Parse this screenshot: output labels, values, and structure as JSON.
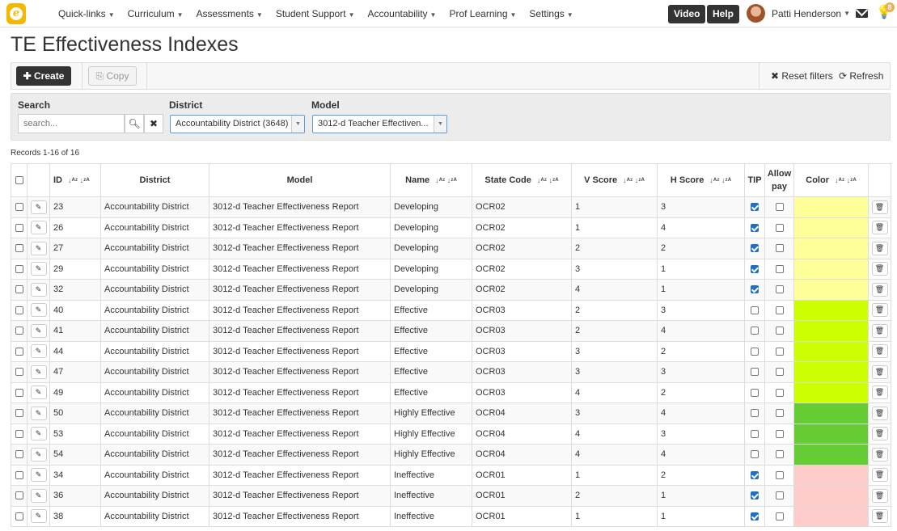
{
  "nav": {
    "logo_letter": "e",
    "menu": [
      "Quick-links",
      "Curriculum",
      "Assessments",
      "Student Support",
      "Accountability",
      "Prof Learning",
      "Settings"
    ],
    "video_label": "Video",
    "help_label": "Help",
    "user_name": "Patti Henderson",
    "notification_count": "8"
  },
  "page": {
    "title": "TE Effectiveness Indexes"
  },
  "toolbar": {
    "create_label": "Create",
    "copy_label": "Copy",
    "reset_label": "Reset filters",
    "refresh_label": "Refresh"
  },
  "filters": {
    "search_label": "Search",
    "search_placeholder": "search...",
    "district_label": "District",
    "district_value": "Accountability District (3648)",
    "model_label": "Model",
    "model_value": "3012-d Teacher Effectiven..."
  },
  "records_text": "Records 1-16 of 16",
  "columns": {
    "id": "ID",
    "district": "District",
    "model": "Model",
    "name": "Name",
    "state_code": "State Code",
    "v_score": "V Score",
    "h_score": "H Score",
    "tip": "TIP",
    "allow_pay": "Allow pay",
    "color": "Color"
  },
  "rows": [
    {
      "id": "23",
      "district": "Accountability District",
      "model": "3012-d Teacher Effectiveness Report",
      "name": "Developing",
      "state_code": "OCR02",
      "v_score": "1",
      "h_score": "3",
      "tip": true,
      "allow_pay": false,
      "color": "#ffff99"
    },
    {
      "id": "26",
      "district": "Accountability District",
      "model": "3012-d Teacher Effectiveness Report",
      "name": "Developing",
      "state_code": "OCR02",
      "v_score": "1",
      "h_score": "4",
      "tip": true,
      "allow_pay": false,
      "color": "#ffff99"
    },
    {
      "id": "27",
      "district": "Accountability District",
      "model": "3012-d Teacher Effectiveness Report",
      "name": "Developing",
      "state_code": "OCR02",
      "v_score": "2",
      "h_score": "2",
      "tip": true,
      "allow_pay": false,
      "color": "#ffff99"
    },
    {
      "id": "29",
      "district": "Accountability District",
      "model": "3012-d Teacher Effectiveness Report",
      "name": "Developing",
      "state_code": "OCR02",
      "v_score": "3",
      "h_score": "1",
      "tip": true,
      "allow_pay": false,
      "color": "#ffff99"
    },
    {
      "id": "32",
      "district": "Accountability District",
      "model": "3012-d Teacher Effectiveness Report",
      "name": "Developing",
      "state_code": "OCR02",
      "v_score": "4",
      "h_score": "1",
      "tip": true,
      "allow_pay": false,
      "color": "#ffff99"
    },
    {
      "id": "40",
      "district": "Accountability District",
      "model": "3012-d Teacher Effectiveness Report",
      "name": "Effective",
      "state_code": "OCR03",
      "v_score": "2",
      "h_score": "3",
      "tip": false,
      "allow_pay": false,
      "color": "#ccff00"
    },
    {
      "id": "41",
      "district": "Accountability District",
      "model": "3012-d Teacher Effectiveness Report",
      "name": "Effective",
      "state_code": "OCR03",
      "v_score": "2",
      "h_score": "4",
      "tip": false,
      "allow_pay": false,
      "color": "#ccff00"
    },
    {
      "id": "44",
      "district": "Accountability District",
      "model": "3012-d Teacher Effectiveness Report",
      "name": "Effective",
      "state_code": "OCR03",
      "v_score": "3",
      "h_score": "2",
      "tip": false,
      "allow_pay": false,
      "color": "#ccff00"
    },
    {
      "id": "47",
      "district": "Accountability District",
      "model": "3012-d Teacher Effectiveness Report",
      "name": "Effective",
      "state_code": "OCR03",
      "v_score": "3",
      "h_score": "3",
      "tip": false,
      "allow_pay": false,
      "color": "#ccff00"
    },
    {
      "id": "49",
      "district": "Accountability District",
      "model": "3012-d Teacher Effectiveness Report",
      "name": "Effective",
      "state_code": "OCR03",
      "v_score": "4",
      "h_score": "2",
      "tip": false,
      "allow_pay": false,
      "color": "#ccff00"
    },
    {
      "id": "50",
      "district": "Accountability District",
      "model": "3012-d Teacher Effectiveness Report",
      "name": "Highly Effective",
      "state_code": "OCR04",
      "v_score": "3",
      "h_score": "4",
      "tip": false,
      "allow_pay": false,
      "color": "#66cc33"
    },
    {
      "id": "53",
      "district": "Accountability District",
      "model": "3012-d Teacher Effectiveness Report",
      "name": "Highly Effective",
      "state_code": "OCR04",
      "v_score": "4",
      "h_score": "3",
      "tip": false,
      "allow_pay": false,
      "color": "#66cc33"
    },
    {
      "id": "54",
      "district": "Accountability District",
      "model": "3012-d Teacher Effectiveness Report",
      "name": "Highly Effective",
      "state_code": "OCR04",
      "v_score": "4",
      "h_score": "4",
      "tip": false,
      "allow_pay": false,
      "color": "#66cc33"
    },
    {
      "id": "34",
      "district": "Accountability District",
      "model": "3012-d Teacher Effectiveness Report",
      "name": "Ineffective",
      "state_code": "OCR01",
      "v_score": "1",
      "h_score": "2",
      "tip": true,
      "allow_pay": false,
      "color": "#ffcccc"
    },
    {
      "id": "36",
      "district": "Accountability District",
      "model": "3012-d Teacher Effectiveness Report",
      "name": "Ineffective",
      "state_code": "OCR01",
      "v_score": "2",
      "h_score": "1",
      "tip": true,
      "allow_pay": false,
      "color": "#ffcccc"
    },
    {
      "id": "38",
      "district": "Accountability District",
      "model": "3012-d Teacher Effectiveness Report",
      "name": "Ineffective",
      "state_code": "OCR01",
      "v_score": "1",
      "h_score": "1",
      "tip": true,
      "allow_pay": false,
      "color": "#ffcccc"
    }
  ]
}
